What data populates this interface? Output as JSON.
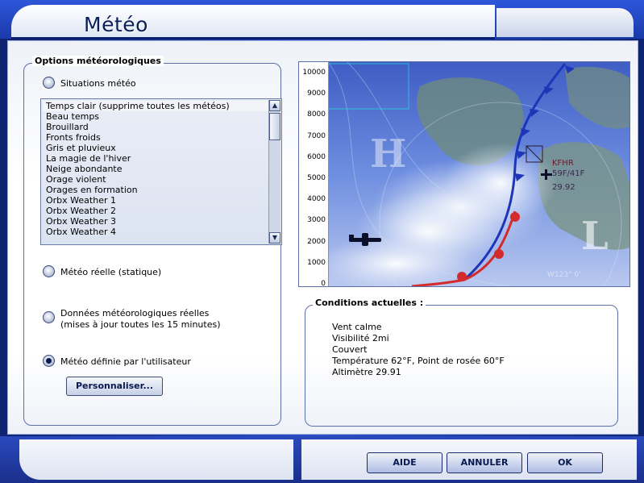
{
  "window": {
    "title": "Météo"
  },
  "options_group": {
    "title": "Options météorologiques"
  },
  "radio": {
    "situations": "Situations météo",
    "real_static": "Météo réelle (statique)",
    "real_updates": "Données météorologiques réelles\n(mises à jour toutes les 15 minutes)",
    "user_defined": "Météo définie par l'utilisateur"
  },
  "themes": [
    "Temps clair (supprime toutes les météos)",
    "Beau temps",
    "Brouillard",
    "Fronts froids",
    "Gris et pluvieux",
    "La magie de l'hiver",
    "Neige abondante",
    "Orage violent",
    "Orages en formation",
    "Orbx Weather 1",
    "Orbx Weather 2",
    "Orbx Weather 3",
    "Orbx Weather 4"
  ],
  "customize_button": "Personnaliser...",
  "map": {
    "y_ticks": [
      "10000",
      "9000",
      "8000",
      "7000",
      "6000",
      "5000",
      "4000",
      "3000",
      "2000",
      "1000",
      "0"
    ],
    "high_label": "H",
    "low_label": "L",
    "station": "KFHR",
    "temp_dew": "59F/41F",
    "pressure": "29.92",
    "longitude": "W123° 0'"
  },
  "conditions": {
    "title": "Conditions actuelles :",
    "lines": [
      "Vent calme",
      "Visibilité 2mi",
      "Couvert",
      "Température 62°F, Point de rosée 60°F",
      "Altimètre 29.91"
    ]
  },
  "buttons": {
    "help": "AIDE",
    "cancel": "ANNULER",
    "ok": "OK"
  },
  "colors": {
    "accent": "#1a3aa9",
    "frame": "#0e2470"
  }
}
